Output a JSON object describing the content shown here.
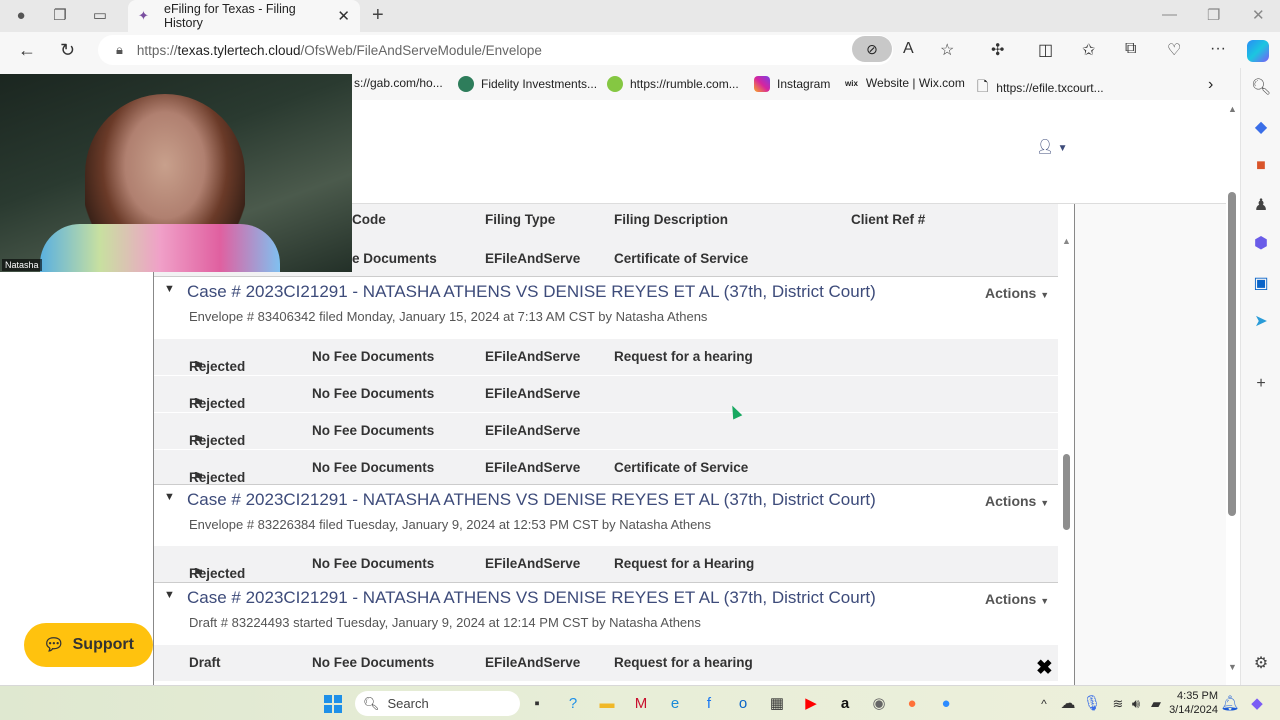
{
  "browser": {
    "tab_title": "eFiling for Texas - Filing History",
    "url_prefix": "https://",
    "url_domain": "texas.tylertech.cloud",
    "url_path": "/OfsWeb/FileAndServeModule/Envelope",
    "bookmarks": [
      {
        "label": "s://gab.com/ho...",
        "icon": "gab-icon"
      },
      {
        "label": "Fidelity Investments...",
        "icon": "fidelity-icon",
        "color": "#2e7d5b"
      },
      {
        "label": "https://rumble.com...",
        "icon": "rumble-icon",
        "color": "#85c742"
      },
      {
        "label": "Instagram",
        "icon": "instagram-icon",
        "color": "#d6249f"
      },
      {
        "label": "Website | Wix.com",
        "icon": "wix-icon"
      },
      {
        "label": "https://efile.txcourt...",
        "icon": "page-icon"
      }
    ]
  },
  "video_overlay": {
    "name": "Natasha"
  },
  "filing_table": {
    "columns": [
      "Code",
      "Filing Type",
      "Filing Description",
      "Client Ref #"
    ],
    "partial_row": {
      "code": "e Documents",
      "filing_type": "EFileAndServe",
      "description": "Certificate of Service"
    },
    "actions_label": "Actions",
    "envelopes": [
      {
        "case_title": "Case # 2023CI21291 - NATASHA ATHENS VS DENISE REYES ET AL (37th, District Court)",
        "subtitle": "Envelope # 83406342 filed Monday, January 15, 2024 at 7:13 AM CST by Natasha Athens",
        "rows": [
          {
            "status": "Rejected",
            "code": "No Fee Documents",
            "filing_type": "EFileAndServe",
            "description": "Request for a hearing"
          },
          {
            "status": "Rejected",
            "code": "No Fee Documents",
            "filing_type": "EFileAndServe",
            "description": ""
          },
          {
            "status": "Rejected",
            "code": "No Fee Documents",
            "filing_type": "EFileAndServe",
            "description": ""
          },
          {
            "status": "Rejected",
            "code": "No Fee Documents",
            "filing_type": "EFileAndServe",
            "description": "Certificate of Service"
          }
        ]
      },
      {
        "case_title": "Case # 2023CI21291 - NATASHA ATHENS VS DENISE REYES ET AL (37th, District Court)",
        "subtitle": "Envelope # 83226384 filed Tuesday, January 9, 2024 at 12:53 PM CST by Natasha Athens",
        "rows": [
          {
            "status": "Rejected",
            "code": "No Fee Documents",
            "filing_type": "EFileAndServe",
            "description": "Request for a Hearing"
          }
        ]
      },
      {
        "case_title": "Case # 2023CI21291 - NATASHA ATHENS VS DENISE REYES ET AL (37th, District Court)",
        "subtitle": "Draft # 83224493 started Tuesday, January 9, 2024 at 12:14 PM CST by Natasha Athens",
        "rows": [
          {
            "status": "Draft",
            "code": "No Fee Documents",
            "filing_type": "EFileAndServe",
            "description": "Request for a hearing"
          }
        ]
      }
    ]
  },
  "support_button": {
    "label": "Support",
    "color": "#ffc20e"
  },
  "taskbar": {
    "search_label": "Search",
    "time": "4:35 PM",
    "date": "3/14/2024"
  },
  "colors": {
    "link": "#3d4b7a",
    "row_bg": "#f2f2f3"
  }
}
